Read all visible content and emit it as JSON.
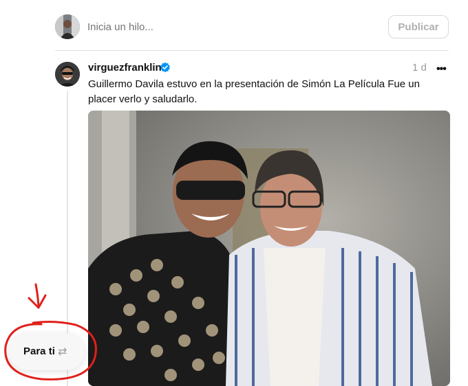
{
  "composer": {
    "placeholder": "Inicia un hilo...",
    "publish_label": "Publicar"
  },
  "post": {
    "username": "virguezfranklin",
    "verified": true,
    "time": "1 d",
    "more_label": "•••",
    "text": "Guillermo Davila estuvo en la presentación de Simón La Película Fue un placer verlo y saludarlo.",
    "photo_alt": "Foto de dos hombres sonriendo"
  },
  "feed_switch": {
    "label": "Para ti",
    "icon": "swap-arrows-icon"
  },
  "colors": {
    "annotation": "#e0201b",
    "verified": "#0095f6",
    "muted_text": "#9a9a9a"
  }
}
